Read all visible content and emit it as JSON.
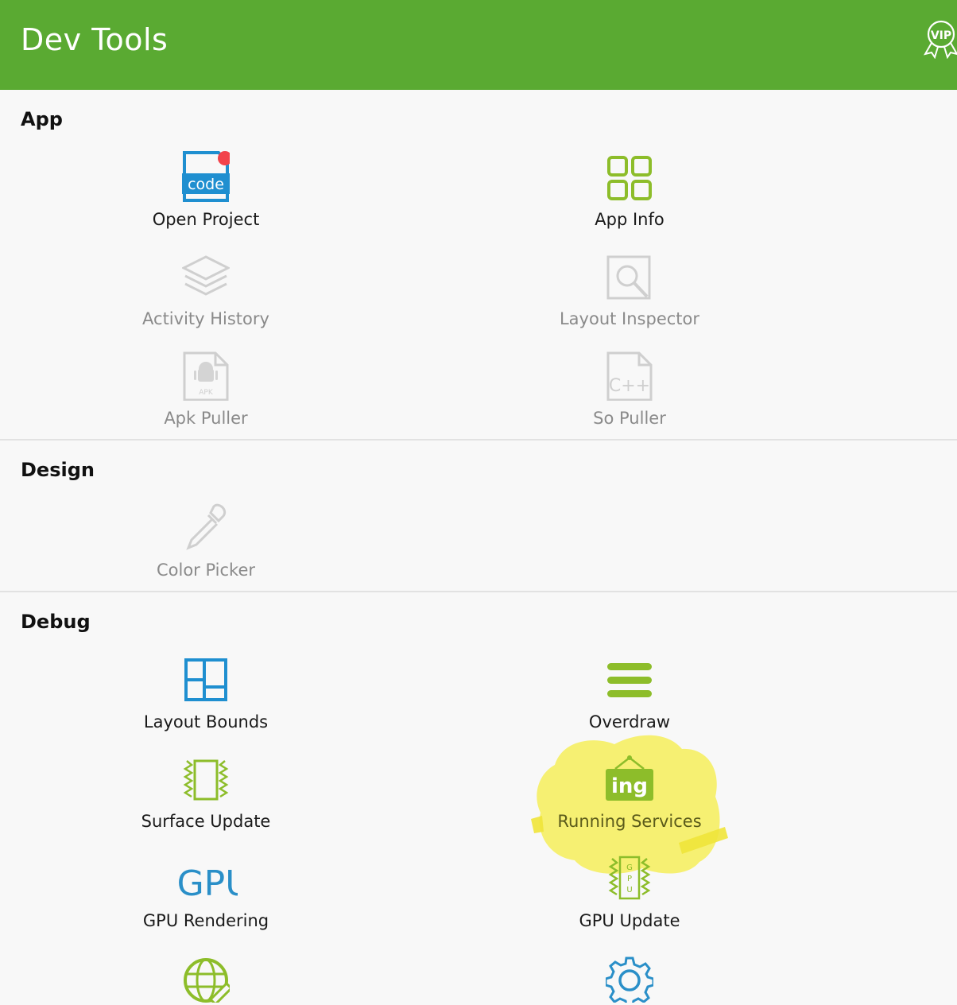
{
  "app_bar": {
    "title": "Dev Tools",
    "icon": "vip-badge-icon",
    "color": "#5aaa32"
  },
  "sections": {
    "app": {
      "title": "App",
      "items": [
        {
          "label": "Open Project",
          "icon": "code-file-icon",
          "enabled": true,
          "badge": true
        },
        {
          "label": "App Info",
          "icon": "grid-icon",
          "enabled": true
        },
        {
          "label": "Activity History",
          "icon": "layers-icon",
          "enabled": false
        },
        {
          "label": "Layout Inspector",
          "icon": "magnifier-icon",
          "enabled": false
        },
        {
          "label": "Apk Puller",
          "icon": "apk-file-icon",
          "enabled": false
        },
        {
          "label": "So Puller",
          "icon": "cpp-file-icon",
          "enabled": false
        }
      ]
    },
    "design": {
      "title": "Design",
      "items": [
        {
          "label": "Color Picker",
          "icon": "eyedropper-icon",
          "enabled": false
        }
      ]
    },
    "debug": {
      "title": "Debug",
      "items": [
        {
          "label": "Layout Bounds",
          "icon": "layout-bounds-icon",
          "enabled": true
        },
        {
          "label": "Overdraw",
          "icon": "overdraw-icon",
          "enabled": true
        },
        {
          "label": "Surface Update",
          "icon": "surface-update-icon",
          "enabled": true
        },
        {
          "label": "Running Services",
          "icon": "running-sign-icon",
          "sign_text": "ing",
          "enabled": true
        },
        {
          "label": "GPU Rendering",
          "icon": "gpu-text-icon",
          "icon_text": "GPU",
          "enabled": true
        },
        {
          "label": "GPU Update",
          "icon": "gpu-chip-icon",
          "chip_letters": [
            "G",
            "P",
            "U"
          ],
          "enabled": true
        }
      ]
    }
  },
  "colors": {
    "accent_green": "#8dbd2a",
    "accent_blue": "#2a8fc8",
    "disabled_gray": "#cfcfcf",
    "highlight_yellow": "#f6ee5a"
  }
}
